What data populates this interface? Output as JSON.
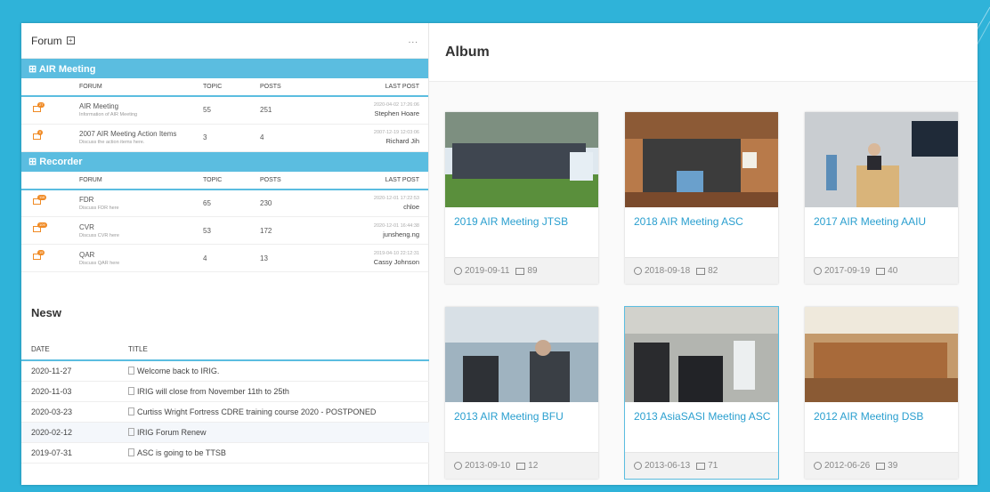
{
  "forum": {
    "title": "Forum",
    "plus_symbol": "⊞",
    "more": "...",
    "headers": {
      "forum": "FORUM",
      "topic": "TOPIC",
      "posts": "POSTS",
      "last_post": "LAST POST"
    },
    "categories": [
      {
        "name": "⊞ AIR Meeting",
        "rows": [
          {
            "badge": "27",
            "name": "AIR Meeting",
            "desc": "Information of AIR Meeting",
            "topic": "55",
            "posts": "251",
            "last_date": "2020-04-02 17:26:06",
            "last_user": "Stephen Hoare"
          },
          {
            "badge": "0",
            "name": "2007 AIR Meeting Action Items",
            "desc": "Discuss the action items here.",
            "topic": "3",
            "posts": "4",
            "last_date": "2007-12-19 12:03:06",
            "last_user": "Richard Jih"
          }
        ]
      },
      {
        "name": "⊞ Recorder",
        "rows": [
          {
            "badge": "116",
            "name": "FDR",
            "desc": "Discuss FDR here",
            "topic": "65",
            "posts": "230",
            "last_date": "2020-12-01 17:22:53",
            "last_user": "chloe"
          },
          {
            "badge": "109",
            "name": "CVR",
            "desc": "Discuss CVR here",
            "topic": "53",
            "posts": "172",
            "last_date": "2020-12-01 16:44:38",
            "last_user": "junsheng.ng"
          },
          {
            "badge": "15",
            "name": "QAR",
            "desc": "Discuss QAR here",
            "topic": "4",
            "posts": "13",
            "last_date": "2019-04-10 22:12:31",
            "last_user": "Cassy Johnson"
          }
        ]
      }
    ]
  },
  "news": {
    "title": "Nesw",
    "headers": {
      "date": "DATE",
      "title": "TITLE"
    },
    "items": [
      {
        "date": "2020-11-27",
        "title": "Welcome back to IRIG."
      },
      {
        "date": "2020-11-03",
        "title": "IRIG will close from November 11th to 25th"
      },
      {
        "date": "2020-03-23",
        "title": "Curtiss Wright Fortress CDRE training course 2020 - POSTPONED"
      },
      {
        "date": "2020-02-12",
        "title": "IRIG Forum Renew"
      },
      {
        "date": "2019-07-31",
        "title": "ASC is going to be TTSB"
      }
    ]
  },
  "album": {
    "title": "Album",
    "cards": [
      {
        "title": "2019 AIR Meeting JTSB",
        "date": "2019-09-11",
        "count": "89"
      },
      {
        "title": "2018 AIR Meeting ASC",
        "date": "2018-09-18",
        "count": "82"
      },
      {
        "title": "2017 AIR Meeting AAIU",
        "date": "2017-09-19",
        "count": "40"
      },
      {
        "title": "2013 AIR Meeting BFU",
        "date": "2013-09-10",
        "count": "12"
      },
      {
        "title": "2013 AsiaSASI Meeting ASC",
        "date": "2013-06-13",
        "count": "71"
      },
      {
        "title": "2012 AIR Meeting DSB",
        "date": "2012-06-26",
        "count": "39"
      }
    ]
  },
  "colors": {
    "accent": "#5bbde0",
    "link": "#2a9fcf",
    "badge": "#f08a24",
    "slide_bg": "#2fb3d9"
  }
}
